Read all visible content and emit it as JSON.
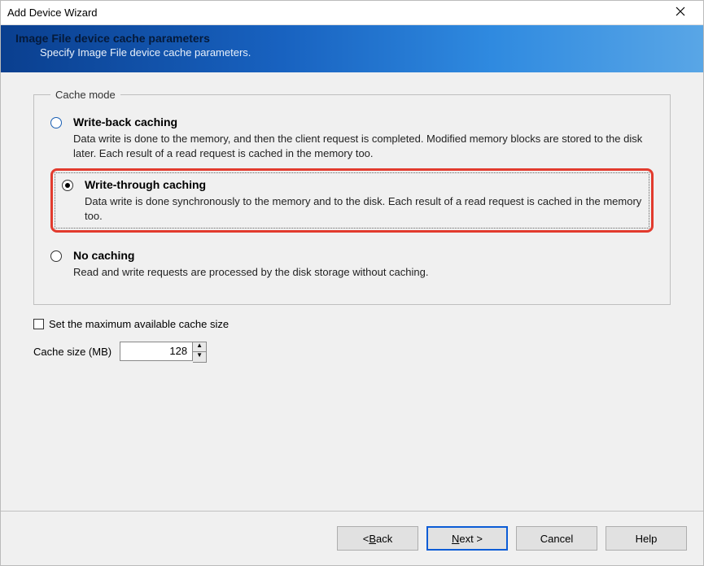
{
  "window": {
    "title": "Add Device Wizard"
  },
  "banner": {
    "title": "Image File device cache parameters",
    "subtitle": "Specify Image File device cache parameters."
  },
  "cacheMode": {
    "legend": "Cache mode",
    "options": [
      {
        "id": "write-back",
        "title": "Write-back caching",
        "desc": "Data write is done to the memory, and then the client request is completed. Modified memory blocks are stored to the disk later. Each result of a read request is cached in the memory too.",
        "selected": false,
        "highlighted": false
      },
      {
        "id": "write-through",
        "title": "Write-through caching",
        "desc": "Data write is done synchronously to the memory and to the disk. Each result of a read request is cached in the memory too.",
        "selected": true,
        "highlighted": true
      },
      {
        "id": "no-caching",
        "title": "No caching",
        "desc": "Read and write requests are processed by the disk storage without caching.",
        "selected": false,
        "highlighted": false
      }
    ]
  },
  "maxCache": {
    "label": "Set the maximum available cache size",
    "checked": false
  },
  "cacheSize": {
    "label": "Cache size (MB)",
    "value": "128"
  },
  "buttons": {
    "back_prefix": "< ",
    "back_u": "B",
    "back_rest": "ack",
    "next_u": "N",
    "next_rest": "ext >",
    "cancel": "Cancel",
    "help": "Help"
  }
}
